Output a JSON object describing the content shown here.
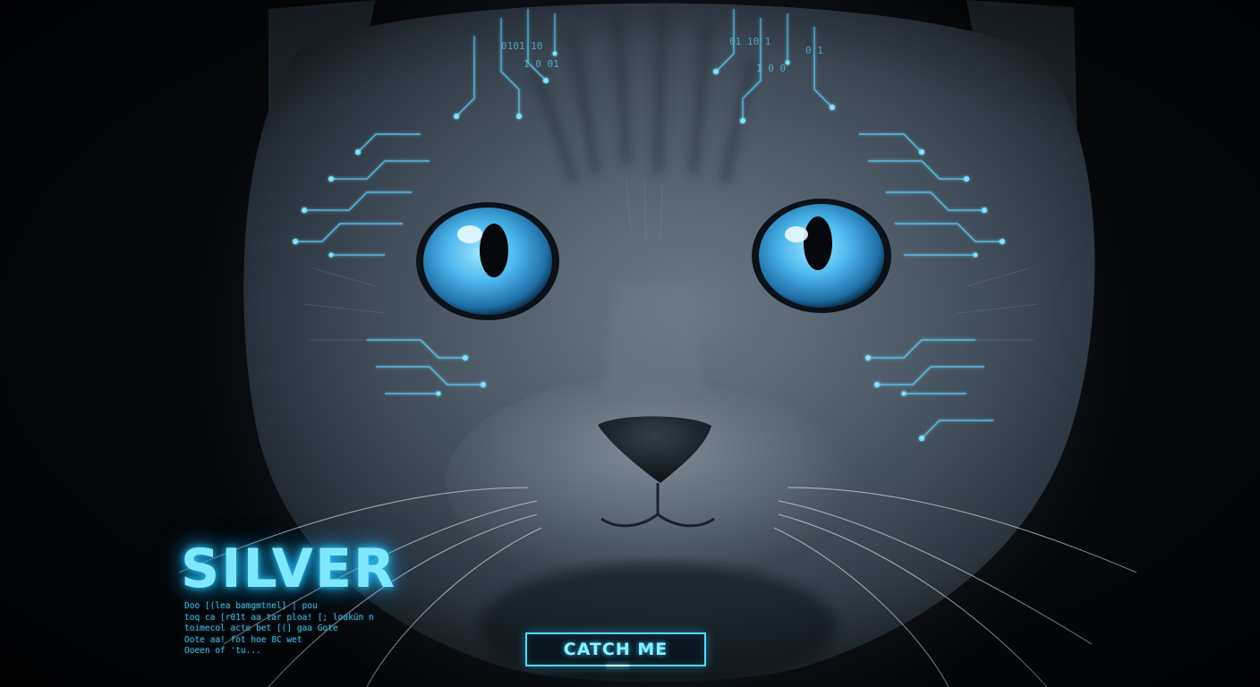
{
  "hero": {
    "title": "SILVER",
    "code_lines": [
      "Doo [(lea bamgmtnel] | pou",
      "toq ca [r01t aa tar ploa! [; loakün n",
      "toimecol acte bet [(] gaa Gote",
      "Oote aa! fot hoe 8C wet",
      "Ooeen of  'tu..."
    ],
    "cta_label": "CATCH ME"
  },
  "colors": {
    "background": "#030508",
    "fur": "#3a4650",
    "eye": "#38a9e6",
    "circuit_glow": "#5fd0ff",
    "title": "#7fe8ff",
    "button_border": "#58d6ff"
  },
  "image": {
    "subject": "grey-cat-face",
    "overlay": "glowing-circuit-lines"
  }
}
